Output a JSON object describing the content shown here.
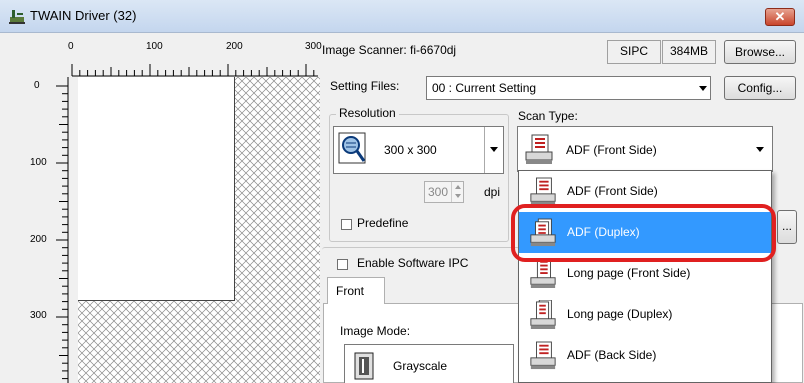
{
  "window": {
    "title": "TWAIN Driver (32)",
    "close_label": "✕"
  },
  "ruler": {
    "h_labels": [
      "0",
      "100",
      "200",
      "300"
    ],
    "v_labels": [
      "0",
      "100",
      "200",
      "300"
    ]
  },
  "scanner": {
    "label": "Image Scanner: fi-6670dj",
    "sipc": "SIPC",
    "memory": "384MB",
    "browse_label": "Browse..."
  },
  "setting_files": {
    "label": "Setting Files:",
    "value": "00 : Current Setting",
    "config_label": "Config..."
  },
  "resolution": {
    "group_label": "Resolution",
    "value": "300 x 300",
    "custom_value": "300",
    "unit": "dpi",
    "predefine_label": "Predefine"
  },
  "scan_type": {
    "label": "Scan Type:",
    "value": "ADF (Front Side)",
    "options": [
      {
        "label": "ADF (Front Side)",
        "selected": false
      },
      {
        "label": "ADF (Duplex)",
        "selected": true
      },
      {
        "label": "Long page (Front Side)",
        "selected": false
      },
      {
        "label": "Long page (Duplex)",
        "selected": false
      },
      {
        "label": "ADF (Back Side)",
        "selected": false
      }
    ]
  },
  "software_ipc": {
    "label": "Enable Software IPC"
  },
  "tabs": {
    "front_label": "Front"
  },
  "image_mode": {
    "label": "Image Mode:",
    "value": "Grayscale"
  },
  "more_button_label": "...",
  "colors": {
    "selected": "#3399ff",
    "highlight": "#e02020"
  }
}
